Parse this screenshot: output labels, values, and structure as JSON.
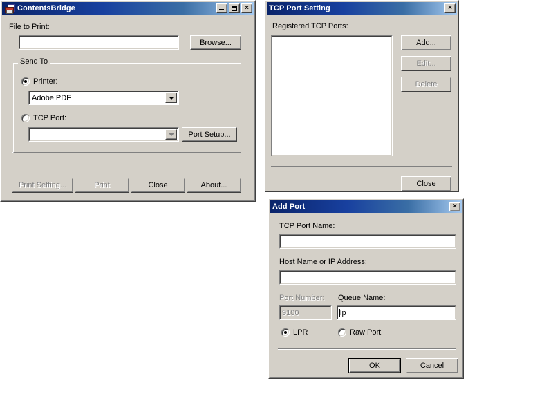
{
  "windows": {
    "contents_bridge": {
      "title": "ContentsBridge",
      "icon": "printer-document-icon",
      "title_buttons": {
        "minimize": "minimize-icon",
        "maximize": "maximize-icon",
        "close": "×"
      },
      "file_to_print_label": "File to Print:",
      "file_to_print_value": "",
      "browse_button": "Browse...",
      "send_to_group": "Send To",
      "printer_radio_label": "Printer:",
      "printer_radio_checked": true,
      "printer_combo_value": "Adobe PDF",
      "tcp_port_radio_label": "TCP Port:",
      "tcp_port_radio_checked": false,
      "tcp_port_combo_value": "",
      "port_setup_button": "Port Setup...",
      "print_setting_button": "Print Setting...",
      "print_setting_disabled": true,
      "print_button": "Print",
      "print_disabled": true,
      "close_button": "Close",
      "about_button": "About..."
    },
    "tcp_port_setting": {
      "title": "TCP Port Setting",
      "close_glyph": "×",
      "registered_label": "Registered TCP Ports:",
      "ports_list": [],
      "add_button": "Add...",
      "edit_button": "Edit...",
      "edit_disabled": true,
      "delete_button": "Delete",
      "delete_disabled": true,
      "close_button": "Close"
    },
    "add_port": {
      "title": "Add Port",
      "close_glyph": "×",
      "tcp_port_name_label": "TCP Port Name:",
      "tcp_port_name_value": "",
      "host_name_label": "Host Name or IP Address:",
      "host_name_value": "",
      "port_number_label": "Port Number:",
      "port_number_value": "9100",
      "port_number_disabled": true,
      "queue_name_label": "Queue Name:",
      "queue_name_value": "lp",
      "lpr_radio_label": "LPR",
      "lpr_radio_checked": true,
      "raw_port_radio_label": "Raw Port",
      "raw_port_radio_checked": false,
      "ok_button": "OK",
      "cancel_button": "Cancel"
    }
  },
  "colors": {
    "face": "#d4d0c8",
    "title_active_start": "#0a246a",
    "title_active_end": "#a6caf0",
    "disabled_text": "#808080",
    "desktop": "#ffffff"
  }
}
